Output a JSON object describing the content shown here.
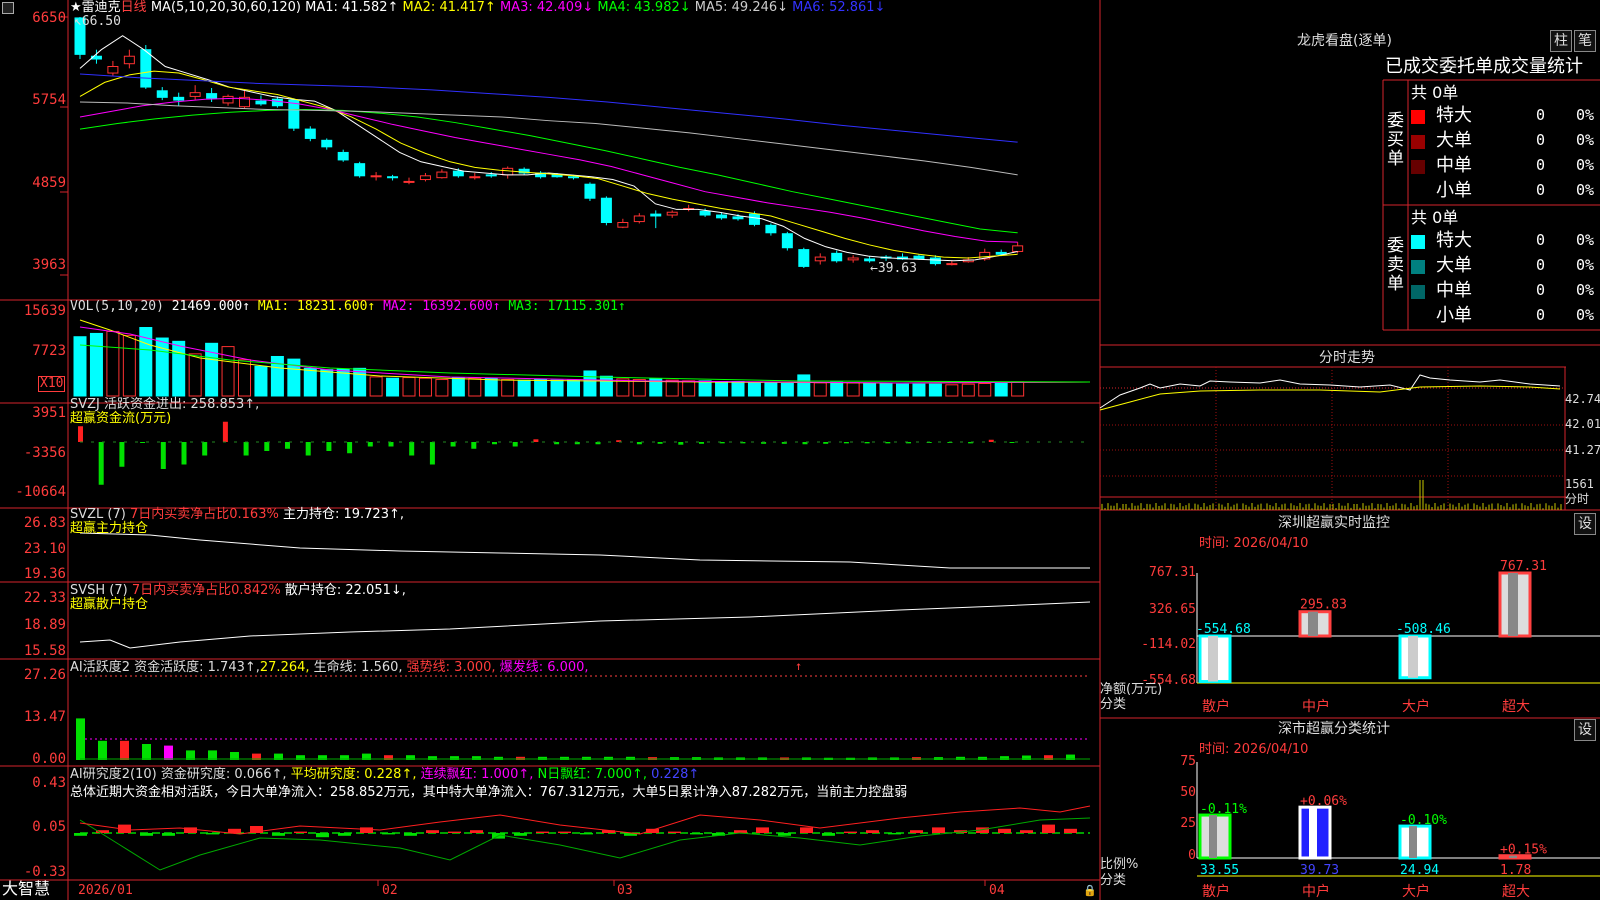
{
  "stock": {
    "icon": "star-icon",
    "name": "雷迪克",
    "period": "日线",
    "ma_header": "MA(5,10,20,30,60,120)",
    "ma_values": [
      {
        "label": "MA1: 41.582↑",
        "color": "#ffffff"
      },
      {
        "label": "MA2: 41.417↑",
        "color": "#ffff00"
      },
      {
        "label": "MA3: 42.409↓",
        "color": "#ff00ff"
      },
      {
        "label": "MA4: 43.982↓",
        "color": "#00ff00"
      },
      {
        "label": "MA5: 49.246↓",
        "color": "#cccccc"
      },
      {
        "label": "MA6: 52.861↓",
        "color": "#3333ff"
      }
    ],
    "price_axis": [
      "6650",
      "5754",
      "4859",
      "3963"
    ],
    "high_marker": "66.50",
    "low_marker": "39.63"
  },
  "volume": {
    "header": "VOL(5,10,20)",
    "value": "21469.000↑",
    "ma": [
      {
        "label": "MA1: 18231.600↑",
        "color": "#ffff00"
      },
      {
        "label": "MA2: 16392.600↑",
        "color": "#ff00ff"
      },
      {
        "label": "MA3: 17115.301↑",
        "color": "#00ff00"
      }
    ],
    "axis": [
      "15639",
      "7723"
    ],
    "unit": "X10"
  },
  "svzj": {
    "header": "SVZJ  活跃资金进出: 258.853↑,",
    "subtitle": "超赢资金流(万元)",
    "axis": [
      "3951",
      "-3356",
      "-10664"
    ]
  },
  "svzl": {
    "header_a": "SVZL (7)",
    "header_b": "7日内买卖净占比0.163%",
    "header_c": "主力持仓: 19.723↑,",
    "subtitle": "超赢主力持仓",
    "axis": [
      "26.83",
      "23.10",
      "19.36"
    ]
  },
  "svsh": {
    "header_a": "SVSH (7)",
    "header_b": "7日内买卖净占比0.842%",
    "header_c": "散户持仓: 22.051↓,",
    "subtitle": "超赢散户持仓",
    "axis": [
      "22.33",
      "18.89",
      "15.58"
    ]
  },
  "ai_active": {
    "header_a": "AI活跃度2 资金活跃度: 1.743↑,",
    "header_b": "27.264,",
    "header_c": "生命线: 1.560,",
    "header_d": "强势线: 3.000,",
    "header_e": "爆发线: 6.000,",
    "axis": [
      "27.26",
      "13.47",
      "0.00"
    ]
  },
  "ai_research": {
    "header_a": "AI研究度2(10) 资金研究度: 0.066↑,",
    "header_b": "平均研究度: 0.228↑,",
    "header_c": "连续飘红: 1.000↑,",
    "header_d": "N日飘红: 7.000↑,",
    "header_e": "0.228↑",
    "summary": "总体近期大资金相对活跃，今日大单净流入：258.852万元，其中特大单净流入：767.312万元，大单5日累计净入87.282万元，当前主力控盘弱",
    "axis": [
      "0.43",
      "0.05",
      "-0.33"
    ]
  },
  "time_axis": [
    "2026/01",
    "02",
    "03",
    "04"
  ],
  "brand": "大智慧",
  "right_panel": {
    "title": "龙虎看盘(逐单)",
    "btn_bar": "柱",
    "btn_bi": "笔",
    "tabs": [
      "已成交",
      "委托单",
      "成交量统计"
    ],
    "buy_group": {
      "label": "委买单",
      "total": "共 0单",
      "rows": [
        {
          "name": "特大",
          "count": "0",
          "pct": "0%",
          "color": "#ff0000"
        },
        {
          "name": "大单",
          "count": "0",
          "pct": "0%",
          "color": "#990000"
        },
        {
          "name": "中单",
          "count": "0",
          "pct": "0%",
          "color": "#660000"
        },
        {
          "name": "小单",
          "count": "0",
          "pct": "0%",
          "color": "#000000"
        }
      ]
    },
    "sell_group": {
      "label": "委卖单",
      "total": "共 0单",
      "rows": [
        {
          "name": "特大",
          "count": "0",
          "pct": "0%",
          "color": "#00ffff"
        },
        {
          "name": "大单",
          "count": "0",
          "pct": "0%",
          "color": "#008080"
        },
        {
          "name": "中单",
          "count": "0",
          "pct": "0%",
          "color": "#006666"
        },
        {
          "name": "小单",
          "count": "0",
          "pct": "0%",
          "color": "#000000"
        }
      ]
    },
    "intraday": {
      "title": "分时走势",
      "axis": [
        "42.74",
        "42.01",
        "41.27",
        "1561",
        "分时"
      ]
    },
    "monitor": {
      "title": "深圳超赢实时监控",
      "btn": "设",
      "time": "时间: 2026/04/10",
      "axis": [
        "767.31",
        "326.65",
        "-114.02",
        "-554.68"
      ],
      "ylabel": "净额(万元)",
      "xlabel": "分类",
      "categories": [
        "散户",
        "中户",
        "大户",
        "超大"
      ],
      "values": [
        -554.68,
        295.83,
        -508.46,
        767.31
      ],
      "value_labels": [
        "-554.68",
        "295.83",
        "-508.46",
        "767.31"
      ]
    },
    "classify": {
      "title": "深市超赢分类统计",
      "btn": "设",
      "time": "时间: 2026/04/10",
      "axis": [
        "75",
        "50",
        "25",
        "0"
      ],
      "ylabel": "比例%",
      "xlabel": "分类",
      "categories": [
        "散户",
        "中户",
        "大户",
        "超大"
      ],
      "values": [
        33.55,
        39.73,
        24.94,
        1.78
      ],
      "value_labels": [
        "33.55",
        "39.73",
        "24.94",
        "1.78"
      ],
      "changes": [
        "-0.11%",
        "+0.06%",
        "-0.10%",
        "+0.15%"
      ]
    }
  }
}
